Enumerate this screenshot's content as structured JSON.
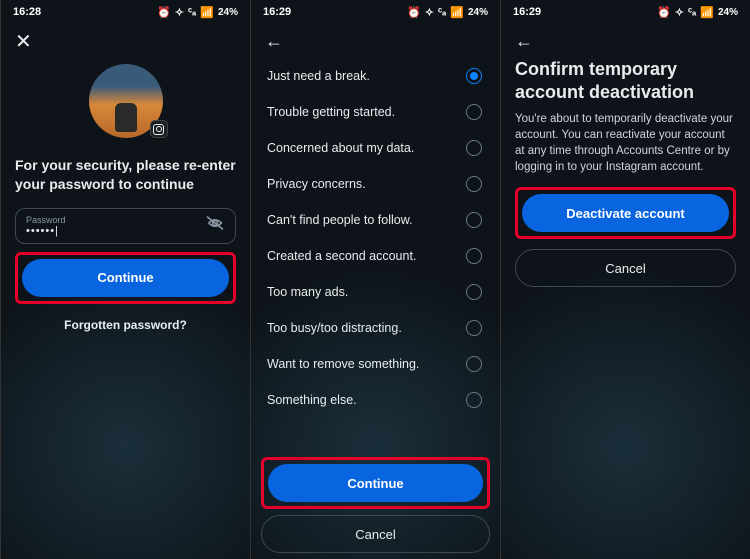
{
  "status": {
    "t1": "16:28",
    "t2": "16:29",
    "t3": "16:29",
    "battery": "24%",
    "icons": "⏰ ❤ 📶 ᯤ ‖"
  },
  "s1": {
    "prompt": "For your security, please re-enter your password to continue",
    "password_label": "Password",
    "password_value": "••••••|",
    "continue": "Continue",
    "forgot": "Forgotten password?"
  },
  "s2": {
    "reasons": [
      "Just need a break.",
      "Trouble getting started.",
      "Concerned about my data.",
      "Privacy concerns.",
      "Can't find people to follow.",
      "Created a second account.",
      "Too many ads.",
      "Too busy/too distracting.",
      "Want to remove something.",
      "Something else."
    ],
    "selected_index": 0,
    "continue": "Continue",
    "cancel": "Cancel"
  },
  "s3": {
    "title": "Confirm temporary account deactivation",
    "desc": "You're about to temporarily deactivate your account. You can reactivate your account at any time through Accounts Centre or by logging in to your Instagram account.",
    "deactivate": "Deactivate account",
    "cancel": "Cancel"
  }
}
